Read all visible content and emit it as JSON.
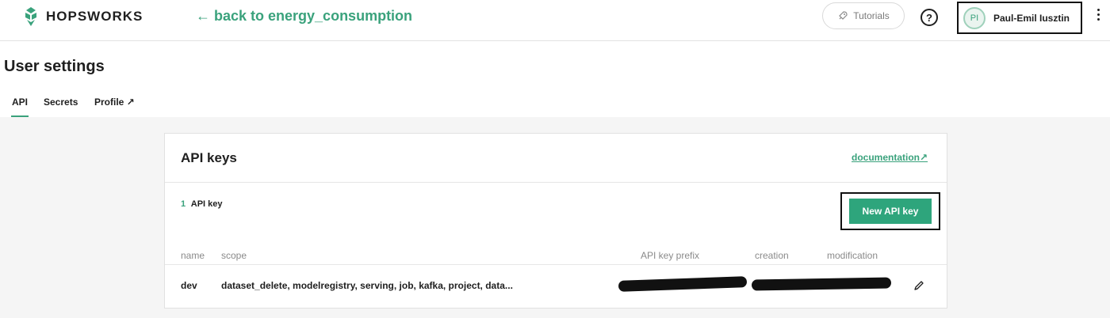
{
  "brand": {
    "name": "HOPSWORKS"
  },
  "header": {
    "back_link": "← back to energy_consumption",
    "tutorials_label": "Tutorials",
    "help_label": "?",
    "user": {
      "initials": "PI",
      "name": "Paul-Emil Iusztin"
    }
  },
  "page": {
    "title": "User settings",
    "tabs": [
      {
        "label": "API"
      },
      {
        "label": "Secrets"
      },
      {
        "label": "Profile ↗"
      }
    ]
  },
  "api_card": {
    "title": "API keys",
    "documentation_label": "documentation↗",
    "count_number": "1",
    "count_label": "API key",
    "new_key_label": "New API key",
    "columns": [
      "name",
      "scope",
      "API key prefix",
      "creation",
      "modification"
    ],
    "rows": [
      {
        "name": "dev",
        "scope": "dataset_delete, modelregistry, serving, job, kafka, project, data..."
      }
    ]
  },
  "colors": {
    "accent": "#3aa27c",
    "button": "#2ea57c"
  },
  "icons": {
    "rocket": "rocket-icon",
    "edit": "pencil-icon",
    "logo": "hop-logo-icon"
  }
}
